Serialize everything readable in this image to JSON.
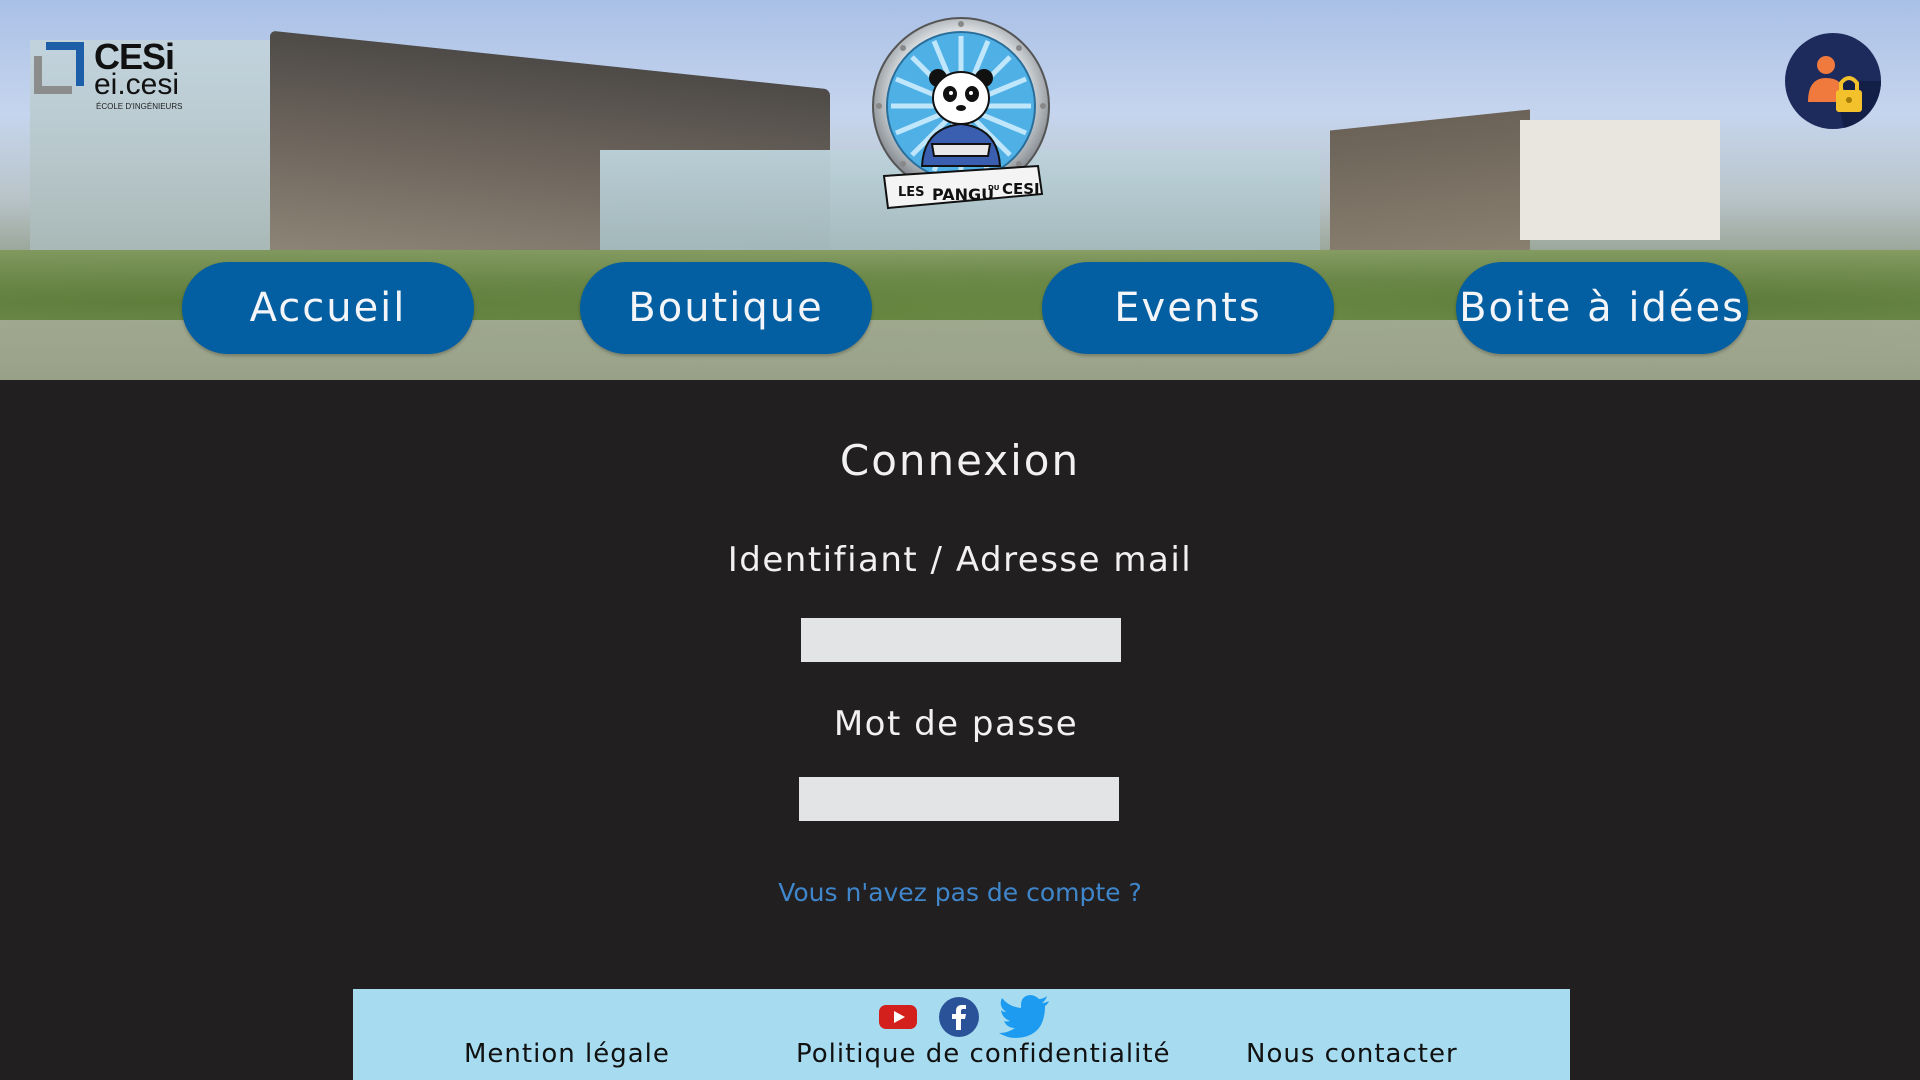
{
  "header": {
    "school_logo": {
      "line1": "CESi",
      "line2": "ei.cesi",
      "line3": "ÉCOLE D'INGÉNIEURS"
    },
    "club_logo": {
      "text_les": "LES",
      "text_pangu": "PANGU",
      "text_du": "DU",
      "text_cesi": "CESI"
    },
    "account_icon": "user-lock-icon"
  },
  "nav": {
    "items": [
      {
        "label": "Accueil"
      },
      {
        "label": "Boutique"
      },
      {
        "label": "Events"
      },
      {
        "label": "Boite à idées"
      }
    ]
  },
  "login": {
    "title": "Connexion",
    "username_label": "Identifiant / Adresse mail",
    "username_value": "",
    "password_label": "Mot de passe",
    "password_value": "",
    "signup_link": "Vous n'avez pas de compte ?"
  },
  "footer": {
    "social": [
      "youtube-icon",
      "facebook-icon",
      "twitter-icon"
    ],
    "legal": "Mention légale",
    "privacy": "Politique de confidentialité",
    "contact": "Nous contacter"
  },
  "colors": {
    "nav_button": "#035ea2",
    "page_background": "#221f21",
    "footer_background": "#a7dcf0",
    "link": "#3f86cb",
    "input_background": "#e3e4e6"
  }
}
